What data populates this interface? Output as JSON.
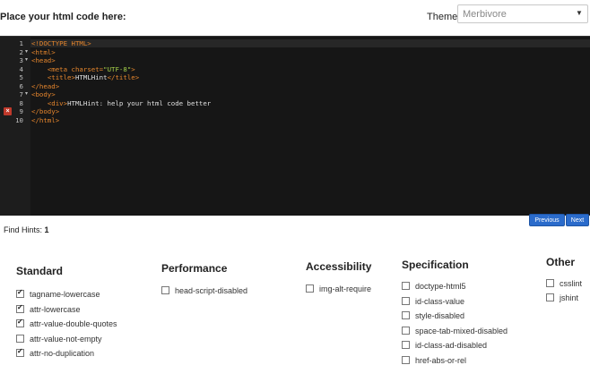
{
  "header": {
    "prompt": "Place your html code here:",
    "theme_label": "Theme:",
    "theme_value": "Merbivore"
  },
  "editor": {
    "lines": [
      {
        "n": "1",
        "fold": "",
        "parts": [
          [
            "tag",
            "<!DOCTYPE HTML>"
          ]
        ]
      },
      {
        "n": "2",
        "fold": "▾",
        "parts": [
          [
            "tag",
            "<html>"
          ]
        ]
      },
      {
        "n": "3",
        "fold": "▾",
        "parts": [
          [
            "tag",
            "<head>"
          ]
        ]
      },
      {
        "n": "4",
        "fold": "",
        "parts": [
          [
            "txt",
            "    "
          ],
          [
            "tag",
            "<meta "
          ],
          [
            "attr",
            "charset="
          ],
          [
            "str",
            "\"UTF-8\""
          ],
          [
            "tag",
            ">"
          ]
        ]
      },
      {
        "n": "5",
        "fold": "",
        "parts": [
          [
            "txt",
            "    "
          ],
          [
            "tag",
            "<title>"
          ],
          [
            "txt",
            "HTMLHint"
          ],
          [
            "tag",
            "</title>"
          ]
        ]
      },
      {
        "n": "6",
        "fold": "",
        "parts": [
          [
            "tag",
            "</head>"
          ]
        ]
      },
      {
        "n": "7",
        "fold": "▾",
        "parts": [
          [
            "tag",
            "<body>"
          ]
        ]
      },
      {
        "n": "8",
        "fold": "",
        "parts": [
          [
            "txt",
            "    "
          ],
          [
            "tag",
            "<div>"
          ],
          [
            "txt",
            "HTMLHint: help your html code better"
          ]
        ]
      },
      {
        "n": "9",
        "fold": "",
        "error": true,
        "parts": [
          [
            "tag",
            "</body>"
          ]
        ]
      },
      {
        "n": "10",
        "fold": "",
        "parts": [
          [
            "tag",
            "</html>"
          ]
        ]
      }
    ]
  },
  "results": {
    "find_hints_label": "Find Hints:",
    "find_hints_count": "1",
    "previous_label": "Previous",
    "next_label": "Next"
  },
  "rule_groups": [
    {
      "title": "Standard",
      "rules": [
        {
          "label": "tagname-lowercase",
          "checked": true
        },
        {
          "label": "attr-lowercase",
          "checked": true
        },
        {
          "label": "attr-value-double-quotes",
          "checked": true
        },
        {
          "label": "attr-value-not-empty",
          "checked": false
        },
        {
          "label": "attr-no-duplication",
          "checked": true
        }
      ]
    },
    {
      "title": "Performance",
      "rules": [
        {
          "label": "head-script-disabled",
          "checked": false
        }
      ]
    },
    {
      "title": "Accessibility",
      "rules": [
        {
          "label": "img-alt-require",
          "checked": false
        }
      ]
    },
    {
      "title": "Specification",
      "rules": [
        {
          "label": "doctype-html5",
          "checked": false
        },
        {
          "label": "id-class-value",
          "checked": false
        },
        {
          "label": "style-disabled",
          "checked": false
        },
        {
          "label": "space-tab-mixed-disabled",
          "checked": false
        },
        {
          "label": "id-class-ad-disabled",
          "checked": false
        },
        {
          "label": "href-abs-or-rel",
          "checked": false
        }
      ]
    },
    {
      "title": "Other",
      "rules": [
        {
          "label": "csslint",
          "checked": false
        },
        {
          "label": "jshint",
          "checked": false
        }
      ]
    }
  ]
}
